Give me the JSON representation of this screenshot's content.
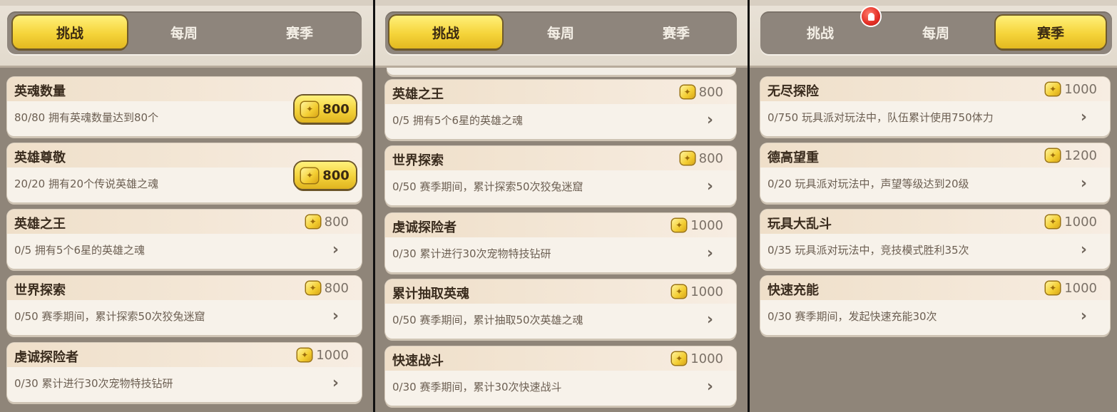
{
  "panels": [
    {
      "tabs": [
        {
          "label": "挑战",
          "active": true
        },
        {
          "label": "每周",
          "active": false
        },
        {
          "label": "赛季",
          "active": false
        }
      ],
      "cards": [
        {
          "title": "英魂数量",
          "desc": "80/80 拥有英魂数量达到80个",
          "reward": "800",
          "state": "claim"
        },
        {
          "title": "英雄尊敬",
          "desc": "20/20 拥有20个传说英雄之魂",
          "reward": "800",
          "state": "claim"
        },
        {
          "title": "英雄之王",
          "desc": "0/5 拥有5个6星的英雄之魂",
          "reward": "800",
          "state": "go"
        },
        {
          "title": "世界探索",
          "desc": "0/50 赛季期间，累计探索50次狡兔迷窟",
          "reward": "800",
          "state": "go"
        },
        {
          "title": "虔诚探险者",
          "desc": "0/30 累计进行30次宠物特技钻研",
          "reward": "1000",
          "state": "go"
        }
      ]
    },
    {
      "tabs": [
        {
          "label": "挑战",
          "active": true
        },
        {
          "label": "每周",
          "active": false
        },
        {
          "label": "赛季",
          "active": false
        }
      ],
      "cards": [
        {
          "title": "英雄之王",
          "desc": "0/5 拥有5个6星的英雄之魂",
          "reward": "800",
          "state": "go"
        },
        {
          "title": "世界探索",
          "desc": "0/50 赛季期间，累计探索50次狡兔迷窟",
          "reward": "800",
          "state": "go"
        },
        {
          "title": "虔诚探险者",
          "desc": "0/30 累计进行30次宠物特技钻研",
          "reward": "1000",
          "state": "go"
        },
        {
          "title": "累计抽取英魂",
          "desc": "0/50 赛季期间，累计抽取50次英雄之魂",
          "reward": "1000",
          "state": "go"
        },
        {
          "title": "快速战斗",
          "desc": "0/30 赛季期间，累计30次快速战斗",
          "reward": "1000",
          "state": "go"
        }
      ]
    },
    {
      "tabs": [
        {
          "label": "挑战",
          "active": false
        },
        {
          "label": "每周",
          "active": false
        },
        {
          "label": "赛季",
          "active": true
        }
      ],
      "cards": [
        {
          "title": "无尽探险",
          "desc": "0/750 玩具派对玩法中，队伍累计使用750体力",
          "reward": "1000",
          "state": "go"
        },
        {
          "title": "德高望重",
          "desc": "0/20 玩具派对玩法中，声望等级达到20级",
          "reward": "1200",
          "state": "go"
        },
        {
          "title": "玩具大乱斗",
          "desc": "0/35 玩具派对玩法中，竞技模式胜利35次",
          "reward": "1000",
          "state": "go"
        },
        {
          "title": "快速充能",
          "desc": "0/30 赛季期间，发起快速充能30次",
          "reward": "1000",
          "state": "go"
        }
      ]
    }
  ],
  "icons": {
    "reward": "gold-gem-icon",
    "arrow": "chevron-right-icon",
    "alert": "bell-icon"
  },
  "colors": {
    "tab_active": "#f5d43a",
    "card_bg": "#f7f2ea",
    "panel_bg": "#8f8579"
  }
}
